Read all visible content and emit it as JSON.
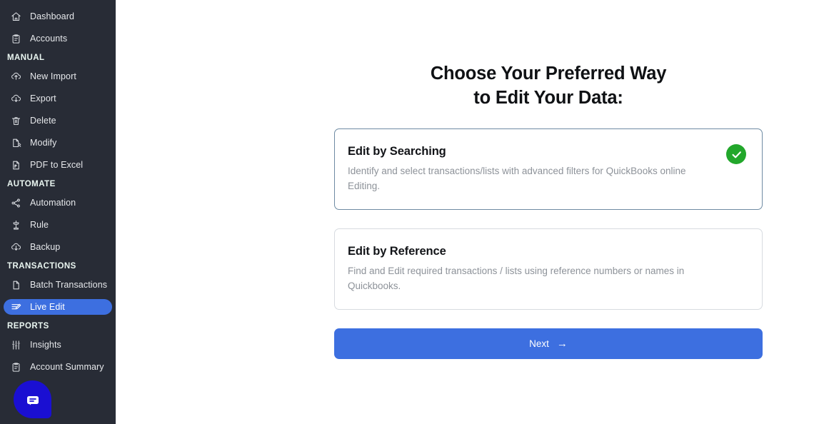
{
  "sidebar": {
    "groups": [
      {
        "header": null,
        "items": [
          {
            "label": "Dashboard",
            "icon": "home-icon",
            "active": false
          },
          {
            "label": "Accounts",
            "icon": "clipboard-icon",
            "active": false
          }
        ]
      },
      {
        "header": "MANUAL",
        "items": [
          {
            "label": "New Import",
            "icon": "upload-cloud-icon",
            "active": false
          },
          {
            "label": "Export",
            "icon": "download-cloud-icon",
            "active": false
          },
          {
            "label": "Delete",
            "icon": "trash-icon",
            "active": false
          },
          {
            "label": "Modify",
            "icon": "file-edit-icon",
            "active": false
          },
          {
            "label": "PDF to Excel",
            "icon": "pdf-file-icon",
            "active": false
          }
        ]
      },
      {
        "header": "AUTOMATE",
        "items": [
          {
            "label": "Automation",
            "icon": "share-nodes-icon",
            "active": false
          },
          {
            "label": "Rule",
            "icon": "rule-stamp-icon",
            "active": false
          },
          {
            "label": "Backup",
            "icon": "download-cloud-icon",
            "active": false
          }
        ]
      },
      {
        "header": "TRANSACTIONS",
        "items": [
          {
            "label": "Batch Transactions",
            "icon": "document-icon",
            "active": false
          },
          {
            "label": "Live Edit",
            "icon": "live-edit-icon",
            "active": true
          }
        ]
      },
      {
        "header": "REPORTS",
        "items": [
          {
            "label": "Insights",
            "icon": "sliders-icon",
            "active": false
          },
          {
            "label": "Account Summary",
            "icon": "clipboard-icon",
            "active": false
          }
        ]
      }
    ],
    "chat_widget": {
      "icon": "chat-bubble-icon"
    },
    "colors": {
      "background": "#282c36",
      "active_item": "#3d6fe0",
      "section_header": "#eaf6f1",
      "chat_fab": "#1a0fd2"
    }
  },
  "main": {
    "headline_line1": "Choose Your Preferred Way",
    "headline_line2": "to Edit Your Data:",
    "options": [
      {
        "title": "Edit by Searching",
        "description": "Identify and select transactions/lists with advanced filters for QuickBooks online Editing.",
        "selected": true,
        "badge_icon": "check-circle-icon"
      },
      {
        "title": "Edit by Reference",
        "description": "Find and Edit required transactions / lists using reference numbers or names in Quickbooks.",
        "selected": false,
        "badge_icon": null
      }
    ],
    "next_button": {
      "label": "Next",
      "icon": "arrow-right-icon"
    },
    "colors": {
      "primary": "#3d6fe0",
      "success": "#22a72b",
      "selected_border": "#6e8ba3",
      "card_border": "#d7dbe0",
      "description_text": "#8d9299"
    }
  }
}
